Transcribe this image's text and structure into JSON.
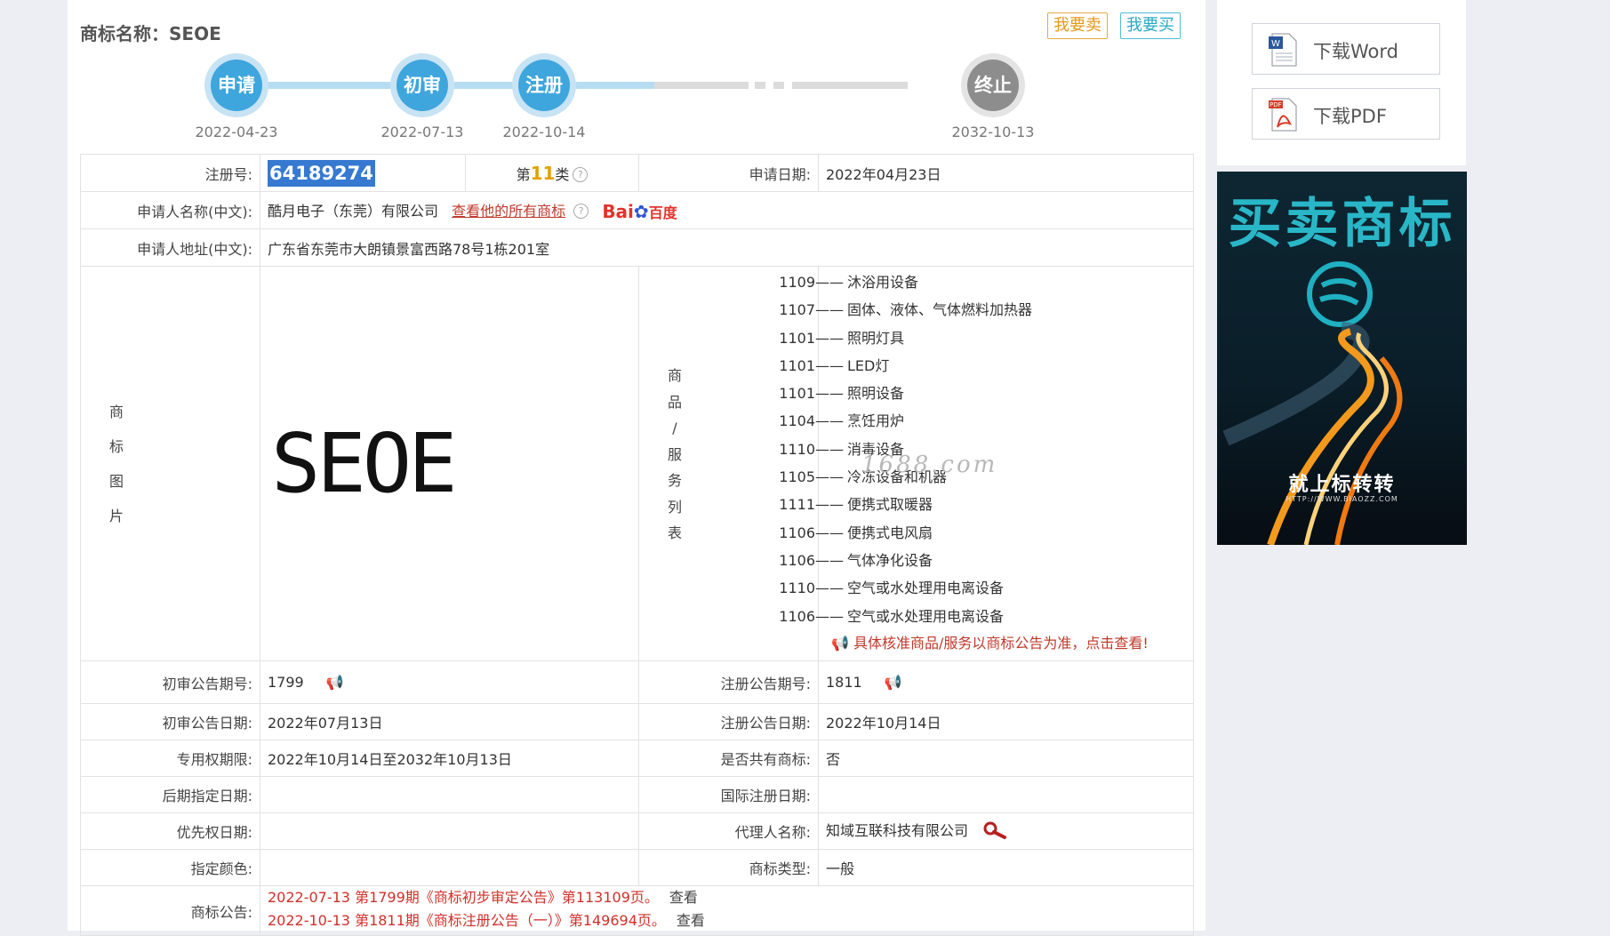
{
  "header": {
    "title": "商标名称：SEOE",
    "sell_label": "我要卖",
    "buy_label": "我要买"
  },
  "timeline": [
    {
      "label": "申请",
      "date": "2022-04-23"
    },
    {
      "label": "初审",
      "date": "2022-07-13"
    },
    {
      "label": "注册",
      "date": "2022-10-14"
    },
    {
      "label": "终止",
      "date": "2032-10-13"
    }
  ],
  "info": {
    "reg_no_label": "注册号:",
    "reg_no": "64189274",
    "class_prefix": "第",
    "class_num": "11",
    "class_suffix": "类",
    "apply_date_label": "申请日期:",
    "apply_date": "2022年04月23日",
    "applicant_label": "申请人名称(中文):",
    "applicant": "酷月电子（东莞）有限公司",
    "all_marks_link": "查看他的所有商标",
    "baidu_text": "Bai",
    "baidu_du": "百度",
    "address_label": "申请人地址(中文):",
    "address": "广东省东莞市大朗镇景富西路78号1栋201室"
  },
  "image_section": {
    "label_chars": [
      "商",
      "标",
      "图",
      "片"
    ],
    "mark_text": "SEOE",
    "goods_label_chars": [
      "商",
      "品",
      "/",
      "服",
      "务",
      "列",
      "表"
    ],
    "watermark": "1688.com",
    "goods": [
      {
        "code": "1109",
        "name": "沐浴用设备"
      },
      {
        "code": "1107",
        "name": "固体、液体、气体燃料加热器"
      },
      {
        "code": "1101",
        "name": "照明灯具"
      },
      {
        "code": "1101",
        "name": "LED灯"
      },
      {
        "code": "1101",
        "name": "照明设备"
      },
      {
        "code": "1104",
        "name": "烹饪用炉"
      },
      {
        "code": "1110",
        "name": "消毒设备"
      },
      {
        "code": "1105",
        "name": "冷冻设备和机器"
      },
      {
        "code": "1111",
        "name": "便携式取暖器"
      },
      {
        "code": "1106",
        "name": "便携式电风扇"
      },
      {
        "code": "1106",
        "name": "气体净化设备"
      },
      {
        "code": "1110",
        "name": "空气或水处理用电离设备"
      },
      {
        "code": "1106",
        "name": "空气或水处理用电离设备"
      }
    ],
    "dash": "——",
    "notice": "具体核准商品/服务以商标公告为准，点击查看!"
  },
  "details": {
    "prelim_no_label": "初审公告期号:",
    "prelim_no": "1799",
    "reg_ann_no_label": "注册公告期号:",
    "reg_ann_no": "1811",
    "prelim_date_label": "初审公告日期:",
    "prelim_date": "2022年07月13日",
    "reg_ann_date_label": "注册公告日期:",
    "reg_ann_date": "2022年10月14日",
    "exclusive_label": "专用权期限:",
    "exclusive": "2022年10月14日至2032年10月13日",
    "shared_label": "是否共有商标:",
    "shared": "否",
    "later_label": "后期指定日期:",
    "later": "",
    "intl_label": "国际注册日期:",
    "intl": "",
    "priority_label": "优先权日期:",
    "priority": "",
    "agent_label": "代理人名称:",
    "agent": "知域互联科技有限公司",
    "color_label": "指定颜色:",
    "color": "",
    "type_label": "商标类型:",
    "type": "一般",
    "announcement_label": "商标公告:",
    "announcements": [
      {
        "text": "2022-07-13 第1799期《商标初步审定公告》第113109页。",
        "view": "查看"
      },
      {
        "text": "2022-10-13 第1811期《商标注册公告（一）》第149694页。",
        "view": "查看"
      }
    ]
  },
  "sidebar": {
    "download_word": "下载Word",
    "download_pdf": "下载PDF",
    "ad_title": "买卖商标",
    "ad_sub": "就上标转转",
    "ad_url": "HTTP://WWW.BIAOZZ.COM"
  },
  "colors": {
    "accent_blue": "#3ea6dd",
    "node_gray": "#8d8d8d",
    "link_red": "#c0392b",
    "sell_orange": "#e39a1c",
    "buy_cyan": "#25a8c4"
  }
}
